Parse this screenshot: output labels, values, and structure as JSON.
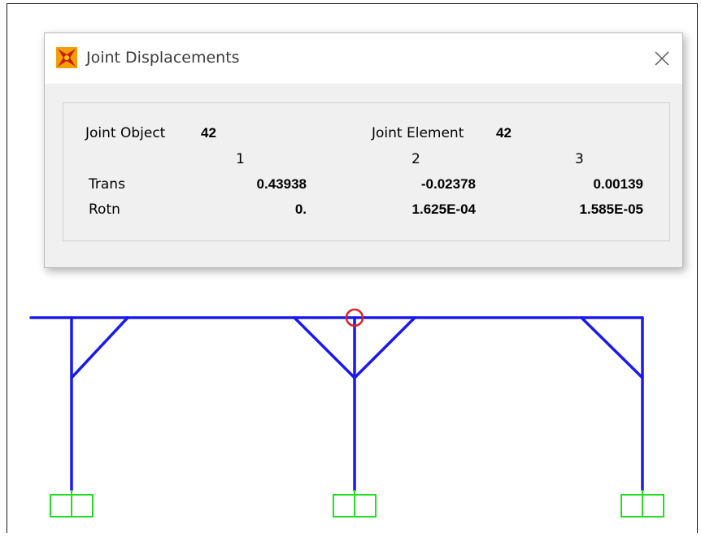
{
  "dialog": {
    "title": "Joint Displacements",
    "icons": {
      "app": "sap2000-app-icon",
      "close": "close-icon"
    },
    "joint_object_label": "Joint  Object",
    "joint_object_value": "42",
    "joint_element_label": "Joint Element",
    "joint_element_value": "42",
    "columns": [
      "1",
      "2",
      "3"
    ],
    "rows": [
      {
        "label": "Trans",
        "values": [
          "0.43938",
          "-0.02378",
          "0.00139"
        ]
      },
      {
        "label": "Rotn",
        "values": [
          "0.",
          "1.625E-04",
          "1.585E-05"
        ]
      }
    ]
  },
  "model": {
    "frame_color": "#1a1aee",
    "support_color": "#22dd22",
    "selection_color": "#dd2222",
    "selected_joint": "42",
    "icons": {
      "support": "fixed-support-icon",
      "selected": "selected-joint-circle-icon"
    }
  }
}
